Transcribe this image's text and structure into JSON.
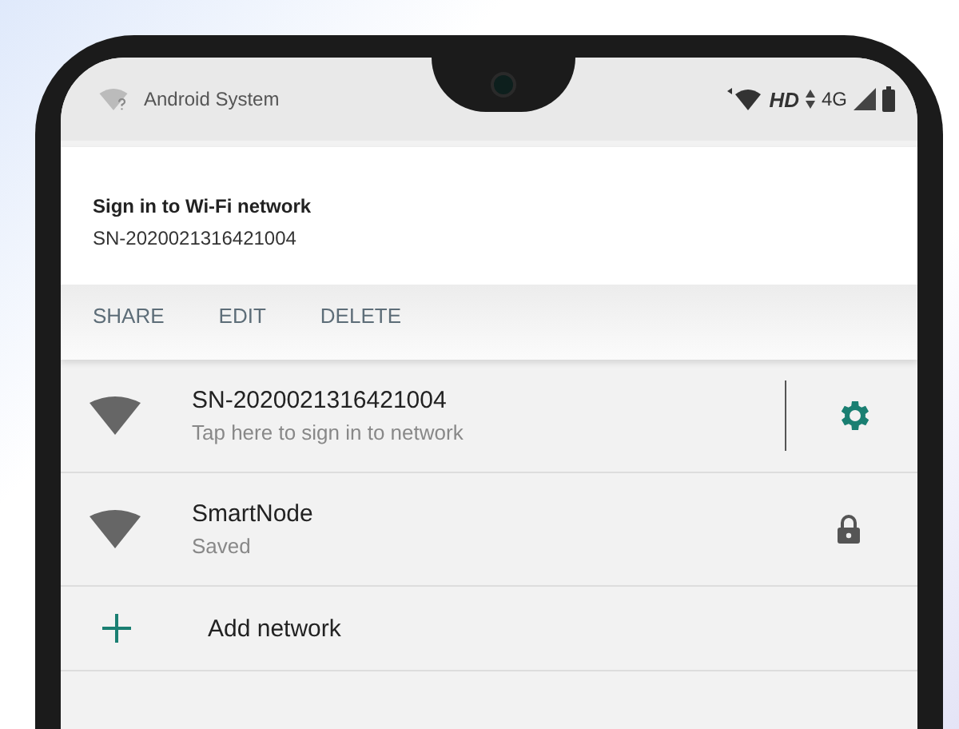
{
  "status_bar": {
    "app": "Android System",
    "hd": "HD",
    "network": "4G"
  },
  "notification": {
    "title": "Sign in to Wi-Fi network",
    "subtitle": "SN-2020021316421004",
    "actions": [
      "SHARE",
      "EDIT",
      "DELETE"
    ]
  },
  "networks": [
    {
      "name": "SN-2020021316421004",
      "status": "Tap here to sign in to network",
      "kind": "settings"
    },
    {
      "name": "SmartNode",
      "status": "Saved",
      "kind": "locked"
    }
  ],
  "add_network": "Add network"
}
